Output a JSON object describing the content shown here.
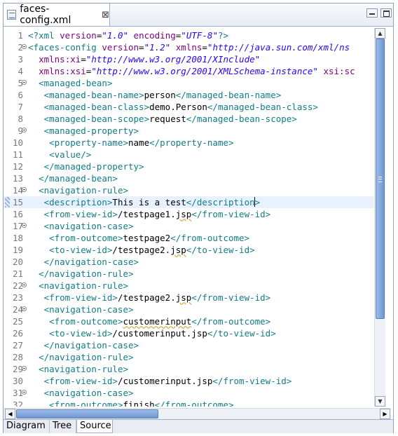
{
  "tab": {
    "file_name": "faces-config.xml",
    "close_icon": "⊠"
  },
  "window_buttons": {
    "minimize": "minimize-icon",
    "maximize": "maximize-icon"
  },
  "bottom_tabs": [
    "Diagram",
    "Tree",
    "Source"
  ],
  "active_bottom_tab": "Source",
  "editor": {
    "current_line": 15,
    "lines": [
      {
        "n": "1",
        "fold": false,
        "segs": [
          [
            "t",
            "<?xml "
          ],
          [
            "a",
            "version"
          ],
          [
            "",
            "="
          ],
          [
            "v",
            "\"1.0\""
          ],
          [
            "",
            " "
          ],
          [
            "a",
            "encoding"
          ],
          [
            "",
            "="
          ],
          [
            "v",
            "\"UTF-8\""
          ],
          [
            "t",
            "?>"
          ]
        ]
      },
      {
        "n": "2",
        "fold": true,
        "segs": [
          [
            "t",
            "<faces-config "
          ],
          [
            "a",
            "version"
          ],
          [
            "",
            "="
          ],
          [
            "v",
            "\"1.2\""
          ],
          [
            "",
            " "
          ],
          [
            "a",
            "xmlns"
          ],
          [
            "",
            "="
          ],
          [
            "v",
            "\"http://java.sun.com/xml/ns"
          ]
        ]
      },
      {
        "n": "3",
        "fold": false,
        "segs": [
          [
            "",
            "  "
          ],
          [
            "a",
            "xmlns:xi"
          ],
          [
            "",
            "="
          ],
          [
            "v",
            "\"http://www.w3.org/2001/XInclude\""
          ]
        ]
      },
      {
        "n": "4",
        "fold": false,
        "segs": [
          [
            "",
            "  "
          ],
          [
            "a",
            "xmlns:xsi"
          ],
          [
            "",
            "="
          ],
          [
            "v",
            "\"http://www.w3.org/2001/XMLSchema-instance\""
          ],
          [
            "",
            " "
          ],
          [
            "a",
            "xsi:sc"
          ]
        ]
      },
      {
        "n": "5",
        "fold": true,
        "segs": [
          [
            "",
            "  "
          ],
          [
            "t",
            "<managed-bean>"
          ]
        ]
      },
      {
        "n": "6",
        "fold": false,
        "segs": [
          [
            "",
            "   "
          ],
          [
            "t",
            "<managed-bean-name>"
          ],
          [
            "",
            "person"
          ],
          [
            "t",
            "</managed-bean-name>"
          ]
        ]
      },
      {
        "n": "7",
        "fold": false,
        "segs": [
          [
            "",
            "   "
          ],
          [
            "t",
            "<managed-bean-class>"
          ],
          [
            "",
            "demo.Person"
          ],
          [
            "t",
            "</managed-bean-class>"
          ]
        ]
      },
      {
        "n": "8",
        "fold": false,
        "segs": [
          [
            "",
            "   "
          ],
          [
            "t",
            "<managed-bean-scope>"
          ],
          [
            "",
            "request"
          ],
          [
            "t",
            "</managed-bean-scope>"
          ]
        ]
      },
      {
        "n": "9",
        "fold": true,
        "segs": [
          [
            "",
            "   "
          ],
          [
            "t",
            "<managed-property>"
          ]
        ]
      },
      {
        "n": "10",
        "fold": false,
        "segs": [
          [
            "",
            "    "
          ],
          [
            "t",
            "<property-name>"
          ],
          [
            "",
            "name"
          ],
          [
            "t",
            "</property-name>"
          ]
        ]
      },
      {
        "n": "11",
        "fold": false,
        "segs": [
          [
            "",
            "    "
          ],
          [
            "t",
            "<value/>"
          ]
        ]
      },
      {
        "n": "12",
        "fold": false,
        "segs": [
          [
            "",
            "   "
          ],
          [
            "t",
            "</managed-property>"
          ]
        ]
      },
      {
        "n": "13",
        "fold": false,
        "segs": [
          [
            "",
            "  "
          ],
          [
            "t",
            "</managed-bean>"
          ]
        ]
      },
      {
        "n": "14",
        "fold": true,
        "segs": [
          [
            "",
            "  "
          ],
          [
            "t",
            "<navigation-rule>"
          ]
        ]
      },
      {
        "n": "15",
        "fold": false,
        "segs": [
          [
            "",
            "   "
          ],
          [
            "t",
            "<description>"
          ],
          [
            "",
            "This is a test"
          ],
          [
            "t",
            "</description>"
          ]
        ]
      },
      {
        "n": "16",
        "fold": false,
        "segs": [
          [
            "",
            "   "
          ],
          [
            "t",
            "<from-view-id>"
          ],
          [
            "",
            "/testpage1."
          ],
          [
            "u",
            "jsp"
          ],
          [
            "t",
            "</from-view-id>"
          ]
        ]
      },
      {
        "n": "17",
        "fold": true,
        "segs": [
          [
            "",
            "   "
          ],
          [
            "t",
            "<navigation-case>"
          ]
        ]
      },
      {
        "n": "18",
        "fold": false,
        "segs": [
          [
            "",
            "    "
          ],
          [
            "t",
            "<from-outcome>"
          ],
          [
            "",
            "testpage2"
          ],
          [
            "t",
            "</from-outcome>"
          ]
        ]
      },
      {
        "n": "19",
        "fold": false,
        "segs": [
          [
            "",
            "    "
          ],
          [
            "t",
            "<to-view-id>"
          ],
          [
            "",
            "/testpage2."
          ],
          [
            "u",
            "jsp"
          ],
          [
            "t",
            "</to-view-id>"
          ]
        ]
      },
      {
        "n": "20",
        "fold": false,
        "segs": [
          [
            "",
            "   "
          ],
          [
            "t",
            "</navigation-case>"
          ]
        ]
      },
      {
        "n": "21",
        "fold": false,
        "segs": [
          [
            "",
            "  "
          ],
          [
            "t",
            "</navigation-rule>"
          ]
        ]
      },
      {
        "n": "22",
        "fold": true,
        "segs": [
          [
            "",
            "  "
          ],
          [
            "t",
            "<navigation-rule>"
          ]
        ]
      },
      {
        "n": "23",
        "fold": false,
        "segs": [
          [
            "",
            "   "
          ],
          [
            "t",
            "<from-view-id>"
          ],
          [
            "",
            "/testpage2."
          ],
          [
            "u",
            "jsp"
          ],
          [
            "t",
            "</from-view-id>"
          ]
        ]
      },
      {
        "n": "24",
        "fold": true,
        "segs": [
          [
            "",
            "   "
          ],
          [
            "t",
            "<navigation-case>"
          ]
        ]
      },
      {
        "n": "25",
        "fold": false,
        "segs": [
          [
            "",
            "    "
          ],
          [
            "t",
            "<from-outcome>"
          ],
          [
            "u",
            "customerinput"
          ],
          [
            "t",
            "</from-outcome>"
          ]
        ]
      },
      {
        "n": "26",
        "fold": false,
        "segs": [
          [
            "",
            "    "
          ],
          [
            "t",
            "<to-view-id>"
          ],
          [
            "",
            "/customerinput.jsp"
          ],
          [
            "t",
            "</to-view-id>"
          ]
        ]
      },
      {
        "n": "27",
        "fold": false,
        "segs": [
          [
            "",
            "   "
          ],
          [
            "t",
            "</navigation-case>"
          ]
        ]
      },
      {
        "n": "28",
        "fold": false,
        "segs": [
          [
            "",
            "  "
          ],
          [
            "t",
            "</navigation-rule>"
          ]
        ]
      },
      {
        "n": "29",
        "fold": true,
        "segs": [
          [
            "",
            "  "
          ],
          [
            "t",
            "<navigation-rule>"
          ]
        ]
      },
      {
        "n": "30",
        "fold": false,
        "segs": [
          [
            "",
            "   "
          ],
          [
            "t",
            "<from-view-id>"
          ],
          [
            "",
            "/customerinput.jsp"
          ],
          [
            "t",
            "</from-view-id>"
          ]
        ]
      },
      {
        "n": "31",
        "fold": true,
        "segs": [
          [
            "",
            "   "
          ],
          [
            "t",
            "<navigation-case>"
          ]
        ]
      },
      {
        "n": "32",
        "fold": false,
        "segs": [
          [
            "",
            "    "
          ],
          [
            "t",
            "<from-outcome>"
          ],
          [
            "",
            "finish"
          ],
          [
            "t",
            "</from-outcome>"
          ]
        ]
      }
    ]
  }
}
